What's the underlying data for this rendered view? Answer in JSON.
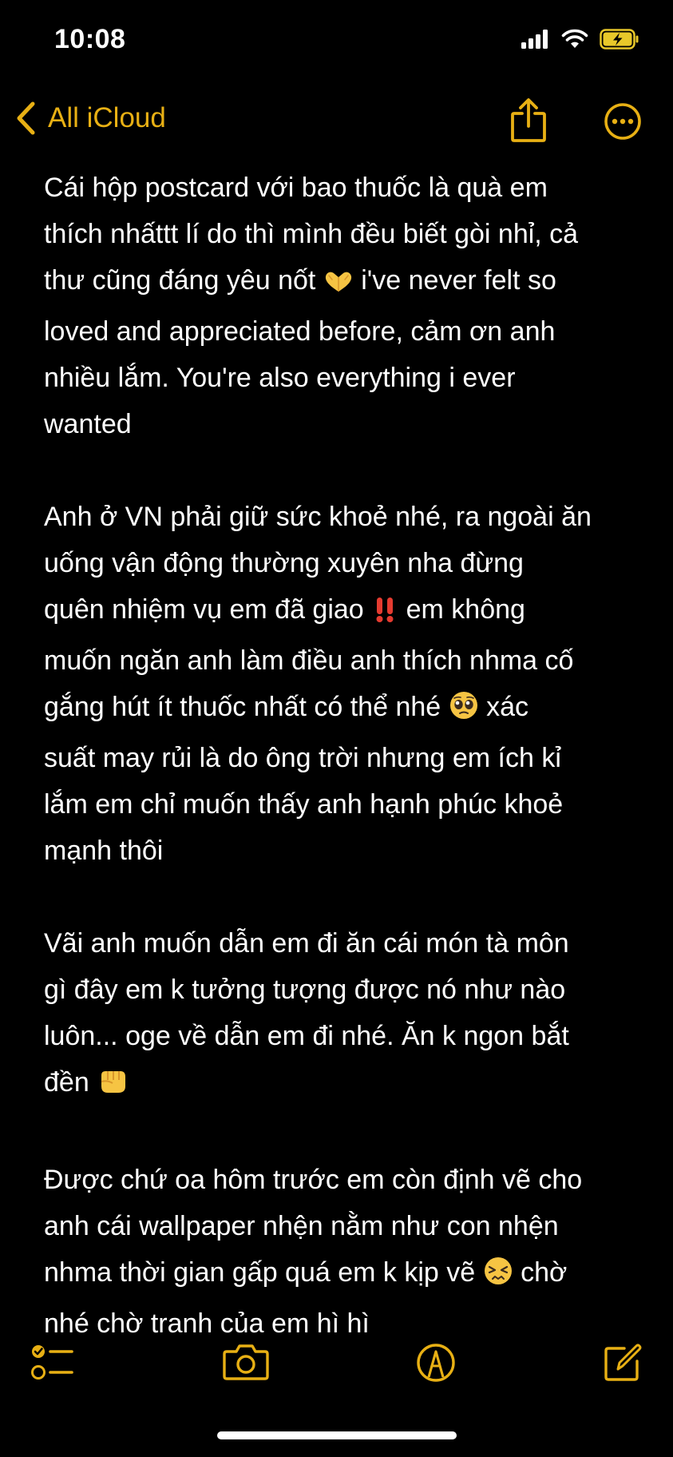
{
  "status_bar": {
    "time": "10:08",
    "icons": [
      "cellular-signal-icon",
      "wifi-icon",
      "battery-charging-icon"
    ]
  },
  "nav": {
    "back_label": "All iCloud",
    "accent_color": "#e8b014",
    "icons": [
      "chevron-left-icon",
      "share-icon",
      "more-icon"
    ]
  },
  "note": {
    "paragraphs": [
      {
        "parts": [
          {
            "t": "Cái hộp postcard với bao thuốc là quà em\nthích nhấttt lí do thì mình đều biết gòi nhỉ, cả\nthư cũng đáng yêu nốt "
          },
          {
            "e": "heart-hands-emoji"
          },
          {
            "t": " i've never felt so\nloved and appreciated before, cảm ơn anh\nnhiều lắm. You're also everything i ever\nwanted"
          }
        ]
      },
      {
        "parts": [
          {
            "t": "Anh ở VN phải giữ sức khoẻ nhé, ra ngoài ăn\nuống vận động thường xuyên nha đừng\nquên nhiệm vụ em đã giao "
          },
          {
            "e": "double-exclamation-emoji"
          },
          {
            "t": " em không\nmuốn ngăn anh làm điều anh thích nhma cố\ngắng hút ít thuốc nhất có thể nhé "
          },
          {
            "e": "pleading-face-emoji"
          },
          {
            "t": " xác\nsuất may rủi là do ông trời nhưng em ích kỉ\nlắm em chỉ muốn thấy anh hạnh phúc khoẻ\nmạnh thôi"
          }
        ]
      },
      {
        "parts": [
          {
            "t": "Vãi anh muốn dẫn em đi ăn cái món tà môn\ngì đây em k tưởng tượng được nó như nào\nluôn... oge về dẫn em đi nhé. Ăn k ngon bắt\nđền "
          },
          {
            "e": "fist-emoji"
          }
        ]
      },
      {
        "parts": [
          {
            "t": "Được chứ oa hôm trước em còn định vẽ cho\nanh cái wallpaper nhện nằm như con nhện\nnhma thời gian gấp quá em k kịp vẽ "
          },
          {
            "e": "persevering-face-emoji"
          },
          {
            "t": " chờ\nnhé chờ tranh của em hì hì"
          }
        ]
      }
    ]
  },
  "toolbar": {
    "icons": [
      "checklist-icon",
      "camera-icon",
      "markup-pen-icon",
      "compose-icon"
    ]
  },
  "colors": {
    "background": "#000000",
    "text": "#ffffff",
    "accent": "#e8b014"
  }
}
